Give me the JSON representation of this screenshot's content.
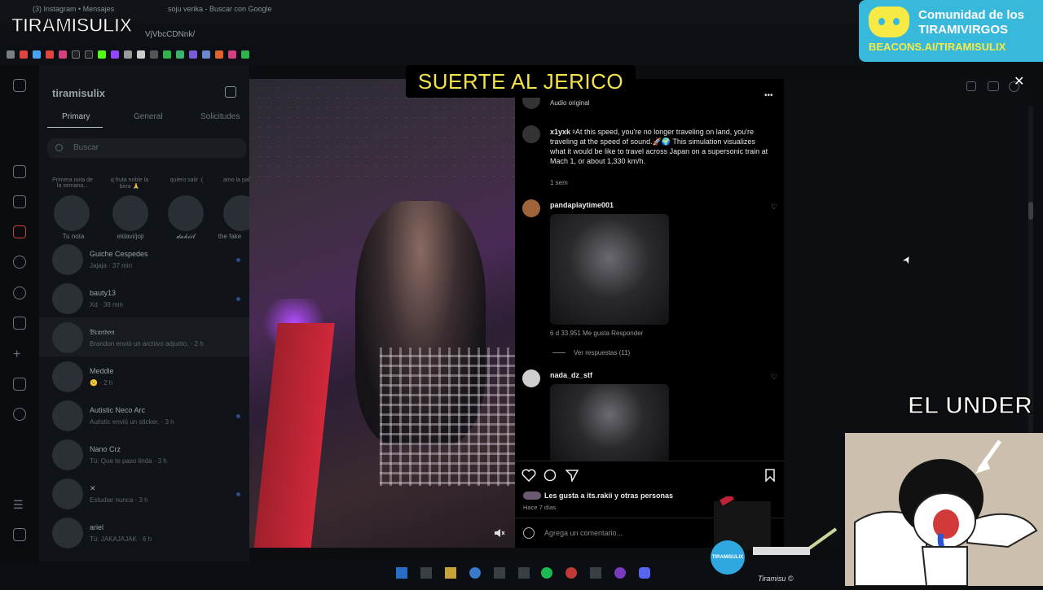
{
  "browser": {
    "tabs": [
      "(3) Instagram • Mensajes",
      "soju verika - Buscar con Google"
    ],
    "url": "VjVbcCDNnk/"
  },
  "overlay": {
    "logo": "TIRAMISULIX",
    "title": "SUERTE AL JERICO",
    "discord_line1": "Comunidad de los",
    "discord_line2": "TIRAMIVIRGOS",
    "discord_line3": "BEACONS.AI/TIRAMISULIX",
    "side_caption": "EL UNDER",
    "mug_label": "TIRAMISULIX",
    "handwriting": "Tiramisu ©"
  },
  "dm": {
    "username": "tiramisulix",
    "tabs": [
      "Primary",
      "General",
      "Solicitudes"
    ],
    "search_placeholder": "Buscar",
    "notes": [
      {
        "note": "Primera nota de la semana...",
        "name": "Tu nota"
      },
      {
        "note": "q fruta noble la birra 🙏",
        "name": "eldavi/joji"
      },
      {
        "note": "quiero salir :(",
        "name": "𝓭𝓪𝓴𝓲𝓲𝓵"
      },
      {
        "note": "amo la paloma",
        "name": "the fake"
      }
    ],
    "conversations": [
      {
        "name": "Guiche Cespedes",
        "sub": "Jajaja · 37 min"
      },
      {
        "name": "bauty13",
        "sub": "Xd · 38 min"
      },
      {
        "name": "𝔅𝔯𝔞𝔫𝔡𝔬𝔫",
        "sub": "Brandon envió un archivo adjunto. · 2 h"
      },
      {
        "name": "Meddle",
        "sub": "🙁 · 2 h"
      },
      {
        "name": "Autistic Neco Arc",
        "sub": "Autistic envió un sticker. · 3 h"
      },
      {
        "name": "Nano Crz",
        "sub": "Tú: Que te paso linda · 3 h"
      },
      {
        "name": "✕",
        "sub": "Estudiar nunca · 3 h"
      },
      {
        "name": "ariel",
        "sub": "Tú: JAKAJAJAK · 6 h"
      }
    ]
  },
  "post": {
    "audio": "Audio original",
    "more": "•••",
    "comments": [
      {
        "user": "x1yxk",
        "text": "ᵖAt this speed, you're no longer traveling on land, you're traveling at the speed of sound.🚀🌍 This simulation visualizes what it would be like to travel across Japan on a supersonic train at Mach 1, or about 1,330 km/h.",
        "meta": "1 sem"
      },
      {
        "user": "pandaplaytime001",
        "meta": "6 d   33.951 Me gusta   Responder",
        "replies": "Ver respuestas (11)"
      },
      {
        "user": "nada_dz_stf"
      }
    ],
    "likes": "Les gusta a its.rakii y otras personas",
    "ago": "Hace 7 días",
    "comment_placeholder": "Agrega un comentario..."
  },
  "icons": {
    "close": "✕",
    "heart": "♡",
    "cursor": "➤"
  }
}
